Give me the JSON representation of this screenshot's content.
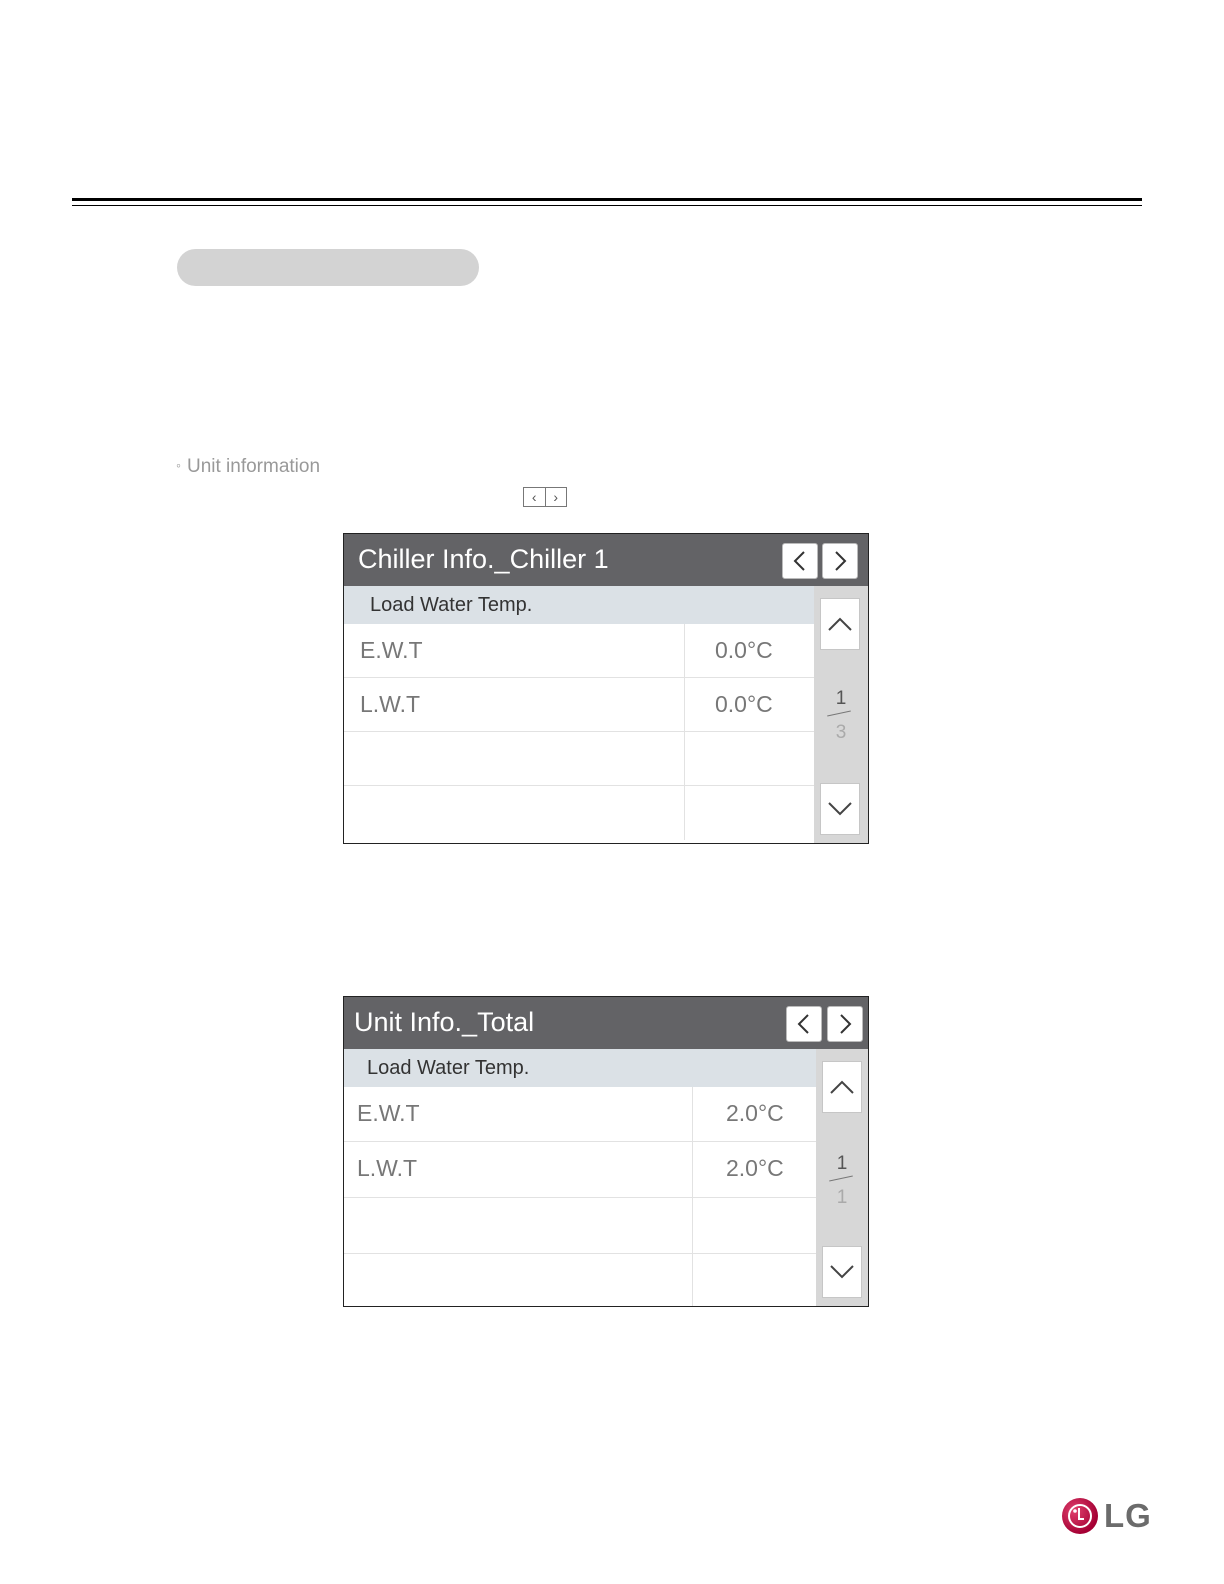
{
  "page": {
    "bullet_text": "Unit information",
    "inline_arrows": {
      "left_icon": "‹",
      "right_icon": "›"
    },
    "logo_text": "LG"
  },
  "panels": [
    {
      "title": "Chiller Info._Chiller 1",
      "section": "Load Water Temp.",
      "rows": [
        {
          "label": "E.W.T",
          "value": "0.0°C"
        },
        {
          "label": "L.W.T",
          "value": "0.0°C"
        },
        {
          "label": "",
          "value": ""
        },
        {
          "label": "",
          "value": ""
        }
      ],
      "page_current": "1",
      "page_total": "3"
    },
    {
      "title": "Unit Info._Total",
      "section": "Load Water Temp.",
      "rows": [
        {
          "label": "E.W.T",
          "value": "2.0°C"
        },
        {
          "label": "L.W.T",
          "value": "2.0°C"
        },
        {
          "label": "",
          "value": ""
        },
        {
          "label": "",
          "value": ""
        }
      ],
      "page_current": "1",
      "page_total": "1"
    }
  ],
  "colors": {
    "header_bg": "#636366",
    "section_bg": "#dbe1e6",
    "sidebar_bg": "#d7d7d7",
    "lg_brand": "#a50034"
  }
}
